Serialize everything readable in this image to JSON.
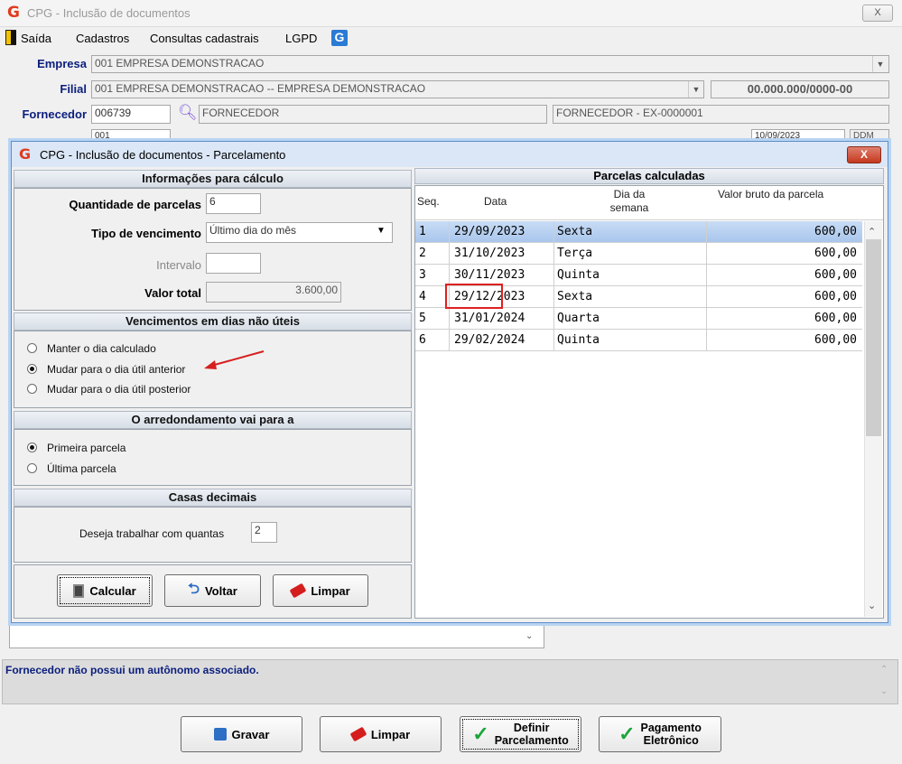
{
  "window": {
    "title": "CPG - Inclusão de documentos",
    "close_label": "X"
  },
  "menu": [
    "Saída",
    "Cadastros",
    "Consultas cadastrais",
    "LGPD"
  ],
  "main_form": {
    "empresa_label": "Empresa",
    "empresa_value": "001 EMPRESA DEMONSTRACAO",
    "filial_label": "Filial",
    "filial_value": "001 EMPRESA DEMONSTRACAO -- EMPRESA DEMONSTRACAO",
    "cnpj": "00.000.000/0000-00",
    "fornecedor_label": "Fornecedor",
    "fornecedor_code": "006739",
    "fornecedor_name": "FORNECEDOR",
    "fornecedor_full": "FORNECEDOR - EX-0000001",
    "serie_value": "001",
    "emissao_value": "10/09/2023",
    "ddm_value": "DDM"
  },
  "dialog": {
    "title": "CPG - Inclusão de documentos - Parcelamento",
    "close_label": "X",
    "info_section": "Informações para cálculo",
    "qtd_label": "Quantidade de parcelas",
    "qtd_value": "6",
    "tipo_label": "Tipo de vencimento",
    "tipo_value": "Último dia do mês",
    "intervalo_label": "Intervalo",
    "intervalo_value": "",
    "valor_label": "Valor total",
    "valor_value": "3.600,00",
    "venc_section": "Vencimentos em dias não úteis",
    "venc_options": [
      "Manter o dia calculado",
      "Mudar para o dia útil anterior",
      "Mudar para o dia útil posterior"
    ],
    "venc_selected": 1,
    "arred_section": "O arredondamento vai para a",
    "arred_options": [
      "Primeira parcela",
      "Última parcela"
    ],
    "arred_selected": 0,
    "casas_section": "Casas decimais",
    "casas_label": "Deseja trabalhar com quantas",
    "casas_value": "2",
    "btn_calcular": "Calcular",
    "btn_voltar": "Voltar",
    "btn_limpar": "Limpar"
  },
  "grid": {
    "title": "Parcelas calculadas",
    "headers": {
      "seq": "Seq.",
      "data": "Data",
      "dia_1": "Dia da",
      "dia_2": "semana",
      "valor": "Valor bruto da parcela"
    },
    "rows": [
      {
        "seq": "1",
        "data": "29/09/2023",
        "dia": "Sexta",
        "valor": "600,00"
      },
      {
        "seq": "2",
        "data": "31/10/2023",
        "dia": "Terça",
        "valor": "600,00"
      },
      {
        "seq": "3",
        "data": "30/11/2023",
        "dia": "Quinta",
        "valor": "600,00"
      },
      {
        "seq": "4",
        "data": "29/12/2023",
        "dia": "Sexta",
        "valor": "600,00"
      },
      {
        "seq": "5",
        "data": "31/01/2024",
        "dia": "Quarta",
        "valor": "600,00"
      },
      {
        "seq": "6",
        "data": "29/02/2024",
        "dia": "Quinta",
        "valor": "600,00"
      }
    ],
    "selected_row": 0
  },
  "status_message": "Fornecedor não possui um autônomo associado.",
  "bottom_buttons": {
    "gravar": "Gravar",
    "limpar": "Limpar",
    "definir_1": "Definir",
    "definir_2": "Parcelamento",
    "pagamento_1": "Pagamento",
    "pagamento_2": "Eletrônico"
  },
  "colors": {
    "accent_blue": "#0b1e7d",
    "selection": "#a9c6ec",
    "annotation_red": "#e02020"
  }
}
